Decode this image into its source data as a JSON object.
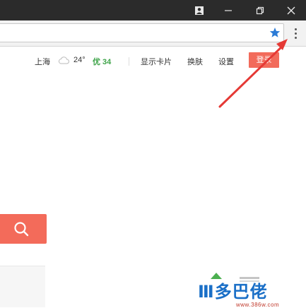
{
  "topnav": {
    "city": "上海",
    "temperature": "24°",
    "air_quality": "优 34",
    "show_card": "显示卡片",
    "skin": "换肤",
    "settings": "设置",
    "login": "登录"
  },
  "watermark": {
    "logo": "Ⅲ多巴佬",
    "url": "www.386w.com"
  },
  "colors": {
    "accent": "#f26b5b",
    "air_quality": "#3fa44a",
    "star": "#2b7bd6",
    "arrow": "#e53935"
  }
}
